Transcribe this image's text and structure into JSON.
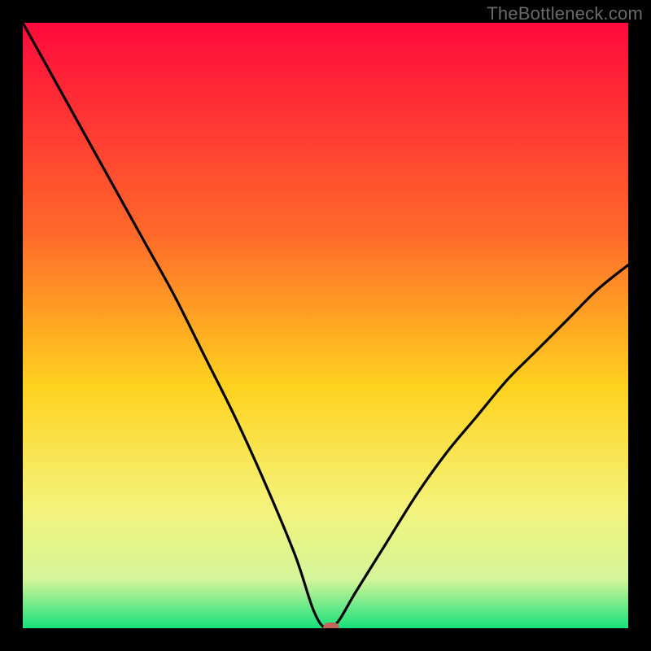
{
  "watermark": "TheBottleneck.com",
  "chart_data": {
    "type": "line",
    "title": "",
    "xlabel": "",
    "ylabel": "",
    "xlim": [
      0,
      100
    ],
    "ylim": [
      0,
      100
    ],
    "series": [
      {
        "name": "bottleneck-curve",
        "x": [
          0,
          5,
          10,
          15,
          20,
          25,
          30,
          35,
          40,
          45,
          48,
          50,
          52,
          55,
          60,
          65,
          70,
          75,
          80,
          85,
          90,
          95,
          100
        ],
        "y": [
          100,
          91,
          82,
          73,
          64,
          55,
          45,
          35,
          24,
          12,
          3,
          0,
          1,
          6,
          14,
          22,
          29,
          35,
          41,
          46,
          51,
          56,
          60
        ]
      }
    ],
    "marker": {
      "x": 51,
      "y": 0,
      "color": "#c2655a"
    },
    "gradient_stops": [
      {
        "offset": 0,
        "color": "#ff0a3c"
      },
      {
        "offset": 35,
        "color": "#ff6a2a"
      },
      {
        "offset": 60,
        "color": "#ffd21f"
      },
      {
        "offset": 80,
        "color": "#f4f37a"
      },
      {
        "offset": 92,
        "color": "#d4f59a"
      },
      {
        "offset": 100,
        "color": "#17e07a"
      }
    ]
  }
}
